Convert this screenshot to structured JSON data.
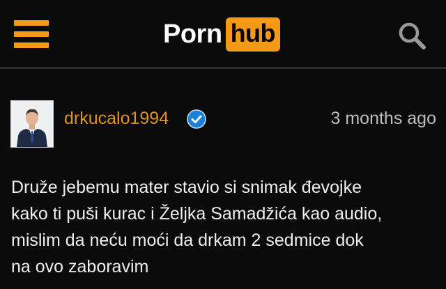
{
  "header": {
    "logo": {
      "left_text": "Porn",
      "right_text": "hub"
    },
    "menu_icon": "hamburger-menu-icon",
    "search_icon": "search-icon"
  },
  "colors": {
    "brand_orange": "#f59a18",
    "background": "#0b0b0b",
    "username": "#e0941b",
    "verified_badge": "#1a7fdc"
  },
  "comment": {
    "username": "drkucalo1994",
    "verified": true,
    "verified_icon": "verified-badge-icon",
    "timestamp": "3 months ago",
    "lines": [
      "Druže jebemu mater stavio si snimak đevojke",
      "kako ti puši kurac i Željka Samadžića kao audio,",
      "mislim da neću moći da drkam 2 sedmice dok",
      "na ovo zaboravim"
    ]
  }
}
